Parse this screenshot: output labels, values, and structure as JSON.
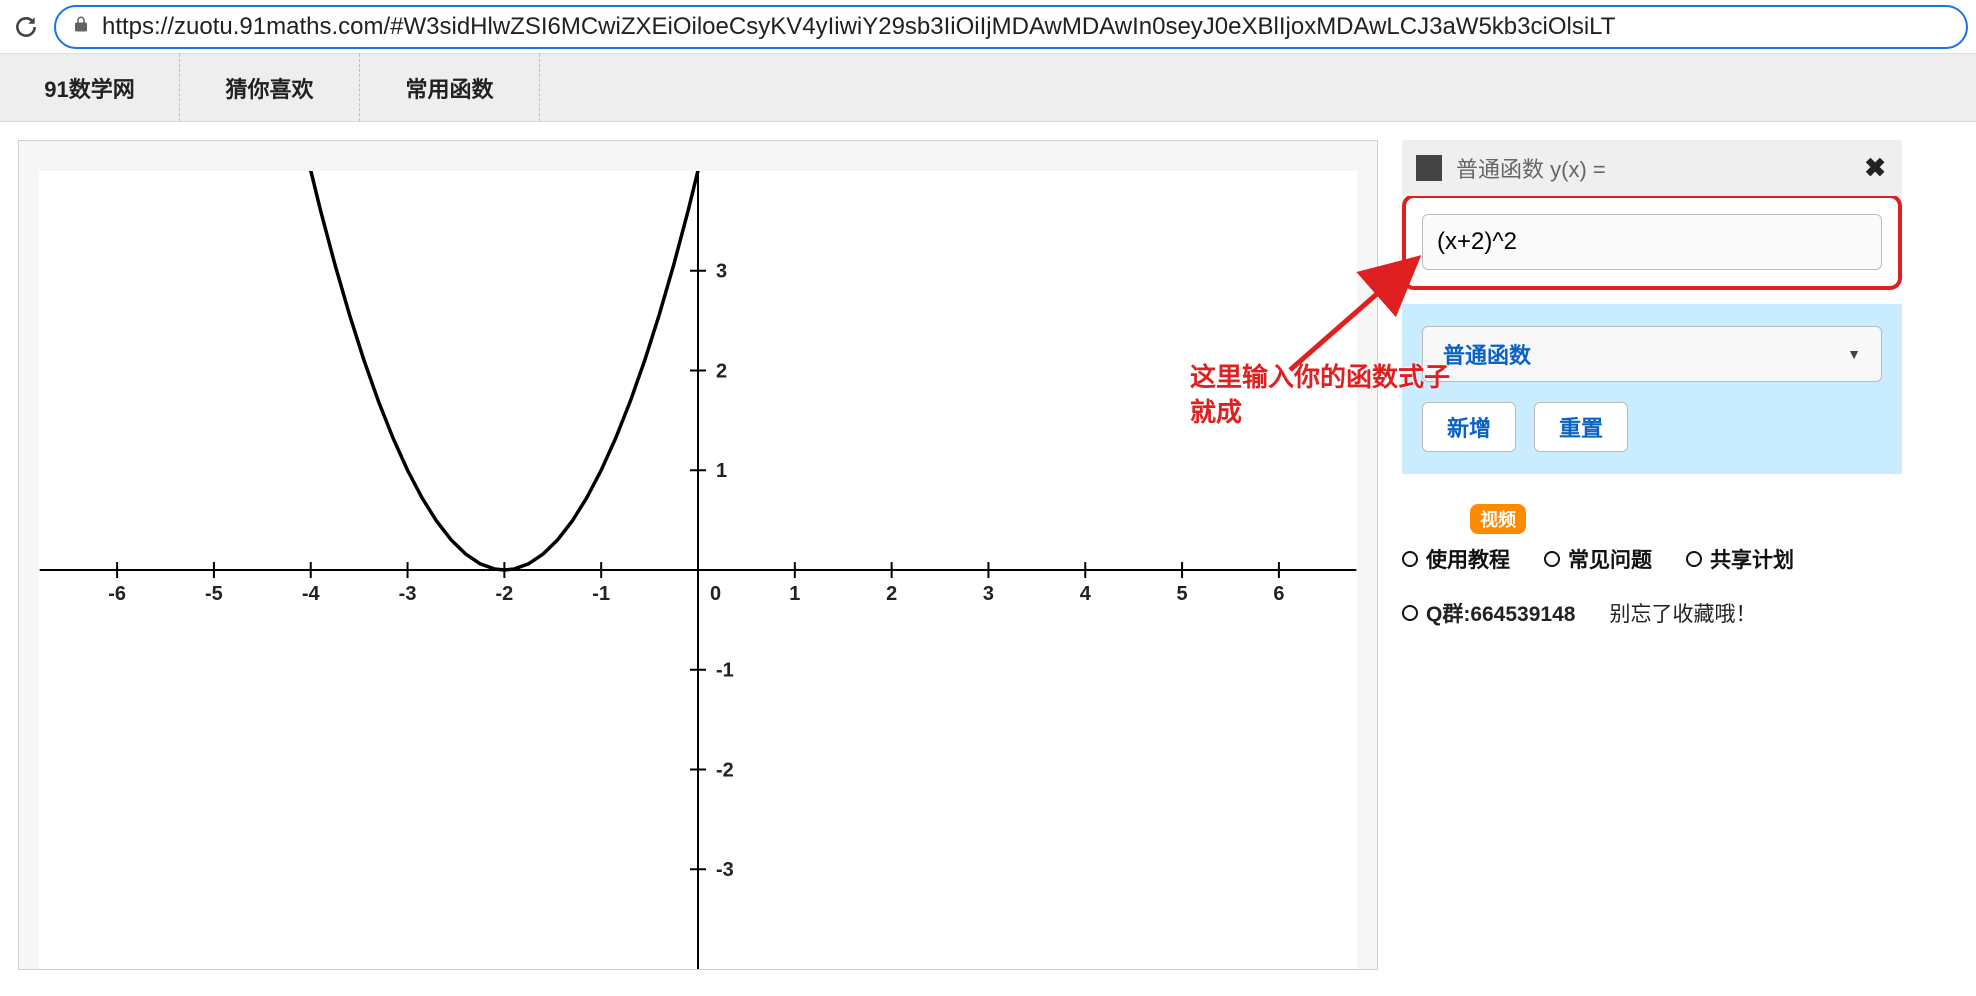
{
  "browser": {
    "url": "https://zuotu.91maths.com/#W3sidHlwZSI6MCwiZXEiOiloeCsyKV4yIiwiY29sb3IiOiIjMDAwMDAwIn0seyJ0eXBlIjoxMDAwLCJ3aW5kb3ciOlsiLT"
  },
  "nav": {
    "tabs": [
      "91数学网",
      "猜你喜欢",
      "常用函数"
    ]
  },
  "sidebar": {
    "header_label": "普通函数 y(x) =",
    "formula_value": "(x+2)^2",
    "dropdown_label": "普通函数",
    "add_btn": "新增",
    "reset_btn": "重置",
    "video_badge": "视频",
    "links": [
      "使用教程",
      "常见问题",
      "共享计划"
    ],
    "qq_label": "Q群:664539148",
    "reminder": "别忘了收藏哦！"
  },
  "annotation": {
    "line1": "这里输入你的函数式子",
    "line2": "就成"
  },
  "chart_data": {
    "type": "line",
    "title": "",
    "xlabel": "",
    "ylabel": "",
    "xlim": [
      -6.8,
      6.8
    ],
    "ylim": [
      -4,
      4
    ],
    "x_ticks": [
      -6,
      -5,
      -4,
      -3,
      -2,
      -1,
      0,
      1,
      2,
      3,
      4,
      5,
      6
    ],
    "y_ticks": [
      -3,
      -2,
      -1,
      0,
      1,
      2,
      3
    ],
    "series": [
      {
        "name": "(x+2)^2",
        "color": "#000000",
        "x": [
          -4.05,
          -3.9,
          -3.75,
          -3.6,
          -3.45,
          -3.3,
          -3.15,
          -3.0,
          -2.85,
          -2.7,
          -2.55,
          -2.4,
          -2.25,
          -2.1,
          -2.0,
          -1.9,
          -1.75,
          -1.6,
          -1.45,
          -1.3,
          -1.15,
          -1.0,
          -0.85,
          -0.7,
          -0.55,
          -0.4,
          -0.25,
          -0.1,
          0.05
        ],
        "y": [
          4.2025,
          3.61,
          3.0625,
          2.56,
          2.1025,
          1.69,
          1.3225,
          1.0,
          0.7225,
          0.49,
          0.3025,
          0.16,
          0.0625,
          0.01,
          0.0,
          0.01,
          0.0625,
          0.16,
          0.3025,
          0.49,
          0.7225,
          1.0,
          1.3225,
          1.69,
          2.1025,
          2.56,
          3.0625,
          3.61,
          4.2025
        ]
      }
    ]
  }
}
